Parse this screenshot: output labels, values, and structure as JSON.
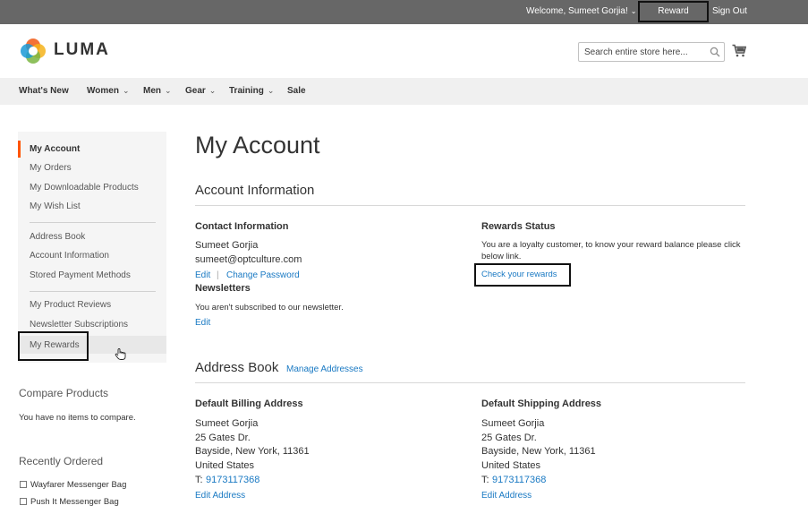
{
  "topbar": {
    "welcome": "Welcome, Sumeet Gorjia!",
    "reward_program": "Reward Program",
    "sign_out": "Sign Out"
  },
  "header": {
    "logo_text": "LUMA",
    "search_placeholder": "Search entire store here...",
    "icons": [
      "search-icon",
      "cart-icon",
      "luma-logo"
    ]
  },
  "nav": {
    "items": [
      {
        "label": "What's New",
        "has_dropdown": false
      },
      {
        "label": "Women",
        "has_dropdown": true
      },
      {
        "label": "Men",
        "has_dropdown": true
      },
      {
        "label": "Gear",
        "has_dropdown": true
      },
      {
        "label": "Training",
        "has_dropdown": true
      },
      {
        "label": "Sale",
        "has_dropdown": false
      }
    ]
  },
  "sidebar": {
    "items": [
      {
        "label": "My Account",
        "active": true
      },
      {
        "label": "My Orders"
      },
      {
        "label": "My Downloadable Products"
      },
      {
        "label": "My Wish List"
      },
      {
        "label": "Address Book"
      },
      {
        "label": "Account Information"
      },
      {
        "label": "Stored Payment Methods"
      },
      {
        "label": "My Product Reviews"
      },
      {
        "label": "Newsletter Subscriptions"
      },
      {
        "label": "My Rewards"
      }
    ],
    "compare": {
      "title": "Compare Products",
      "empty_text": "You have no items to compare."
    },
    "recent": {
      "title": "Recently Ordered",
      "items": [
        "Wayfarer Messenger Bag",
        "Push It Messenger Bag"
      ]
    }
  },
  "main": {
    "title": "My Account",
    "account_info": {
      "title": "Account Information",
      "contact": {
        "title": "Contact Information",
        "name": "Sumeet Gorjia",
        "email": "sumeet@optculture.com",
        "edit": "Edit",
        "separator": "|",
        "change_password": "Change Password"
      },
      "newsletters": {
        "title": "Newsletters",
        "text": "You aren't subscribed to our newsletter.",
        "edit": "Edit"
      },
      "rewards": {
        "title": "Rewards Status",
        "text_line1": "You are a loyalty customer, to know your reward balance please click",
        "text_line2": "below link.",
        "link": "Check your rewards"
      }
    },
    "address_book": {
      "title": "Address Book",
      "manage": "Manage Addresses",
      "billing": {
        "title": "Default Billing Address",
        "name": "Sumeet Gorjia",
        "street": "25 Gates Dr.",
        "city": "Bayside, New York, 11361",
        "country": "United States",
        "phone_prefix": "T:",
        "phone": "9173117368",
        "edit": "Edit Address"
      },
      "shipping": {
        "title": "Default Shipping Address",
        "name": "Sumeet Gorjia",
        "street": "25 Gates Dr.",
        "city": "Bayside, New York, 11361",
        "country": "United States",
        "phone_prefix": "T:",
        "phone": "9173117368",
        "edit": "Edit Address"
      }
    }
  },
  "colors": {
    "topbar_bg": "#676767",
    "accent_orange": "#ff5501",
    "link_blue": "#1979c3",
    "nav_bg": "#f0f0f0",
    "sidebar_bg": "#f5f5f5"
  }
}
